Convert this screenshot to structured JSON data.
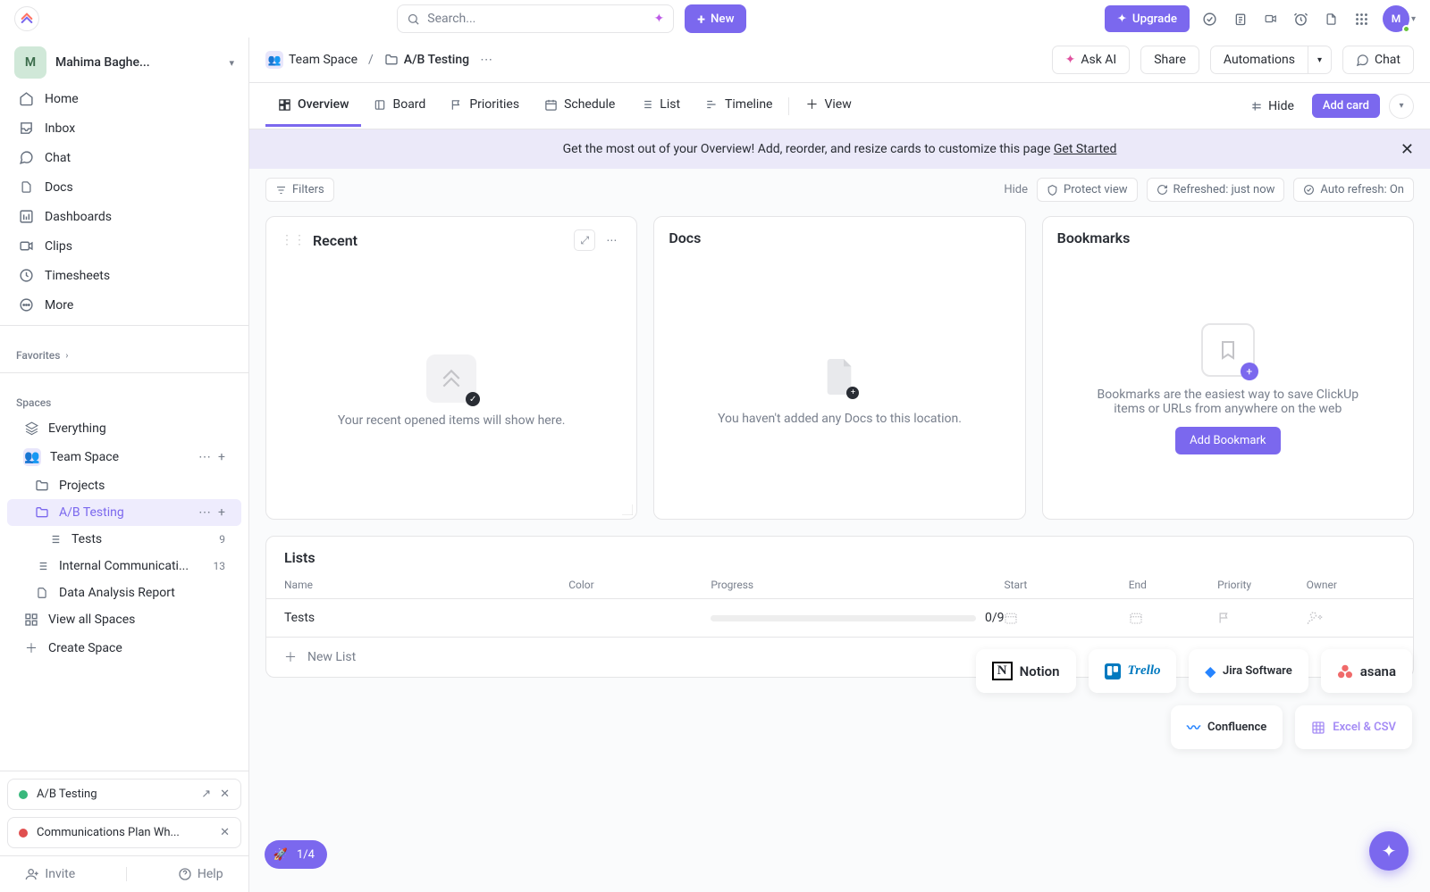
{
  "top": {
    "search_placeholder": "Search...",
    "new_label": "New",
    "upgrade_label": "Upgrade",
    "avatar_initial": "M"
  },
  "workspace": {
    "initial": "M",
    "name": "Mahima Baghe..."
  },
  "nav": {
    "home": "Home",
    "inbox": "Inbox",
    "chat": "Chat",
    "docs": "Docs",
    "dashboards": "Dashboards",
    "clips": "Clips",
    "timesheets": "Timesheets",
    "more": "More"
  },
  "favorites_label": "Favorites",
  "spaces_label": "Spaces",
  "tree": {
    "everything": "Everything",
    "team_space": "Team Space",
    "projects": "Projects",
    "ab_testing": "A/B Testing",
    "tests": "Tests",
    "tests_count": "9",
    "internal_comm": "Internal Communicati...",
    "internal_comm_count": "13",
    "data_analysis": "Data Analysis Report",
    "view_all_spaces": "View all Spaces",
    "create_space": "Create Space"
  },
  "bottom_cards": [
    {
      "status": "complete",
      "label": "A/B Testing"
    },
    {
      "status": "todo",
      "label": "Communications Plan Wh..."
    }
  ],
  "footer": {
    "invite": "Invite",
    "help": "Help"
  },
  "breadcrumb": {
    "team_space": "Team Space",
    "ab_testing": "A/B Testing"
  },
  "header_buttons": {
    "ask_ai": "Ask AI",
    "share": "Share",
    "automations": "Automations",
    "chat": "Chat"
  },
  "tabs": {
    "overview": "Overview",
    "board": "Board",
    "priorities": "Priorities",
    "schedule": "Schedule",
    "list": "List",
    "timeline": "Timeline",
    "view": "View"
  },
  "tabs_right": {
    "hide": "Hide",
    "add_card": "Add card"
  },
  "banner": {
    "text": "Get the most out of your Overview! Add, reorder, and resize cards to customize this page ",
    "link": "Get Started"
  },
  "filters": {
    "filters": "Filters",
    "hide": "Hide",
    "protect": "Protect view",
    "refreshed": "Refreshed: just now",
    "auto": "Auto refresh: On"
  },
  "cards": {
    "recent": {
      "title": "Recent",
      "empty": "Your recent opened items will show here."
    },
    "docs": {
      "title": "Docs",
      "empty": "You haven't added any Docs to this location."
    },
    "bookmarks": {
      "title": "Bookmarks",
      "empty": "Bookmarks are the easiest way to save ClickUp items or URLs from anywhere on the web",
      "button": "Add Bookmark"
    }
  },
  "lists": {
    "title": "Lists",
    "headers": {
      "name": "Name",
      "color": "Color",
      "progress": "Progress",
      "start": "Start",
      "end": "End",
      "priority": "Priority",
      "owner": "Owner"
    },
    "rows": [
      {
        "name": "Tests",
        "progress": "0/9"
      }
    ],
    "new_list": "New List"
  },
  "integrations": {
    "notion": "Notion",
    "trello": "Trello",
    "jira": "Jira Software",
    "asana": "asana",
    "confluence": "Confluence",
    "excel": "Excel & CSV"
  },
  "progress_pill": "1/4"
}
